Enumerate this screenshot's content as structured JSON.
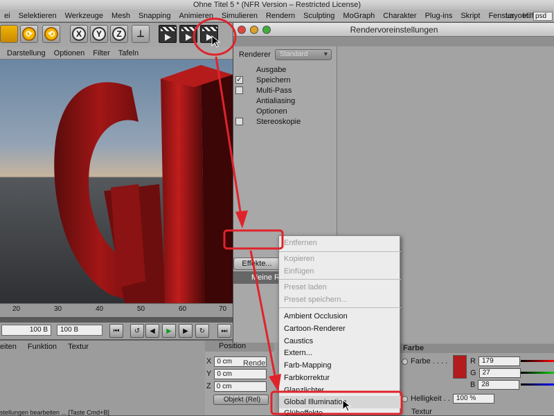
{
  "window": {
    "title": "Ohne Titel 5 * (NFR Version – Restricted License)"
  },
  "menubar": {
    "items": [
      "ei",
      "Selektieren",
      "Werkzeuge",
      "Mesh",
      "Snapping",
      "Animieren",
      "Simulieren",
      "Rendern",
      "Sculpting",
      "MoGraph",
      "Charakter",
      "Plug-ins",
      "Skript",
      "Fenster",
      "Hilfe"
    ],
    "layout_label": "Layout:",
    "layout_value": "psd"
  },
  "toolbar": {
    "axis_x": "X",
    "axis_y": "Y",
    "axis_z": "Z"
  },
  "viewport": {
    "menu": [
      "Darstellung",
      "Optionen",
      "Filter",
      "Tafeln"
    ]
  },
  "timeline": {
    "ticks": [
      "20",
      "30",
      "40",
      "50",
      "60",
      "70"
    ],
    "frame_start": "100 B",
    "frame_end": "100 B"
  },
  "lower_panel": {
    "menu": [
      "eiten",
      "Funktion",
      "Textur"
    ],
    "position_header": "Position",
    "coords": [
      {
        "axis": "X",
        "value": "0 cm"
      },
      {
        "axis": "Y",
        "value": "0 cm"
      },
      {
        "axis": "Z",
        "value": "0 cm"
      }
    ],
    "mode_select": "Objekt (Rel)",
    "status": "stellungen bearbeiten ... [Taste Cmd+B]"
  },
  "render_settings": {
    "title": "Rendervoreinstellungen",
    "renderer_label": "Renderer",
    "renderer_value": "Standard",
    "items": [
      {
        "label": "Ausgabe",
        "checkbox": false,
        "checked": false
      },
      {
        "label": "Speichern",
        "checkbox": true,
        "checked": true
      },
      {
        "label": "Multi-Pass",
        "checkbox": true,
        "checked": false
      },
      {
        "label": "Antialiasing",
        "checkbox": false,
        "checked": false
      },
      {
        "label": "Optionen",
        "checkbox": false,
        "checked": false
      },
      {
        "label": "Stereoskopie",
        "checkbox": true,
        "checked": false
      }
    ],
    "effects_button": "Effekte...",
    "preset_item": "Meine Re",
    "render_button": "Rende"
  },
  "context_menu": {
    "items": [
      {
        "label": "Entfernen",
        "disabled": true
      },
      {
        "label": "Kopieren",
        "disabled": true
      },
      {
        "label": "Einfügen",
        "disabled": true
      },
      {
        "label": "Preset laden",
        "disabled": true
      },
      {
        "label": "Preset speichern...",
        "disabled": true
      },
      {
        "label": "Ambient Occlusion",
        "disabled": false
      },
      {
        "label": "Cartoon-Renderer",
        "disabled": false
      },
      {
        "label": "Caustics",
        "disabled": false
      },
      {
        "label": "Extern...",
        "disabled": false
      },
      {
        "label": "Farb-Mapping",
        "disabled": false
      },
      {
        "label": "Farbkorrektur",
        "disabled": false
      },
      {
        "label": "Glanzlichter",
        "disabled": false
      },
      {
        "label": "Global Illumination",
        "disabled": false,
        "highlighted": true
      },
      {
        "label": "Glüheffekte",
        "disabled": false
      }
    ]
  },
  "farbe_panel": {
    "header": "Farbe",
    "color_label": "Farbe . . . .",
    "r_label": "R",
    "r_value": "179",
    "g_label": "G",
    "g_value": "27",
    "b_label": "B",
    "b_value": "28",
    "swatch_color": "#b31b1c",
    "helligkeit_label": "Helligkeit . .",
    "helligkeit_value": "100 %",
    "textur_label": "Textur"
  },
  "colors": {
    "annotation_red": "#e0232b",
    "letter_red": "#8f1212"
  }
}
